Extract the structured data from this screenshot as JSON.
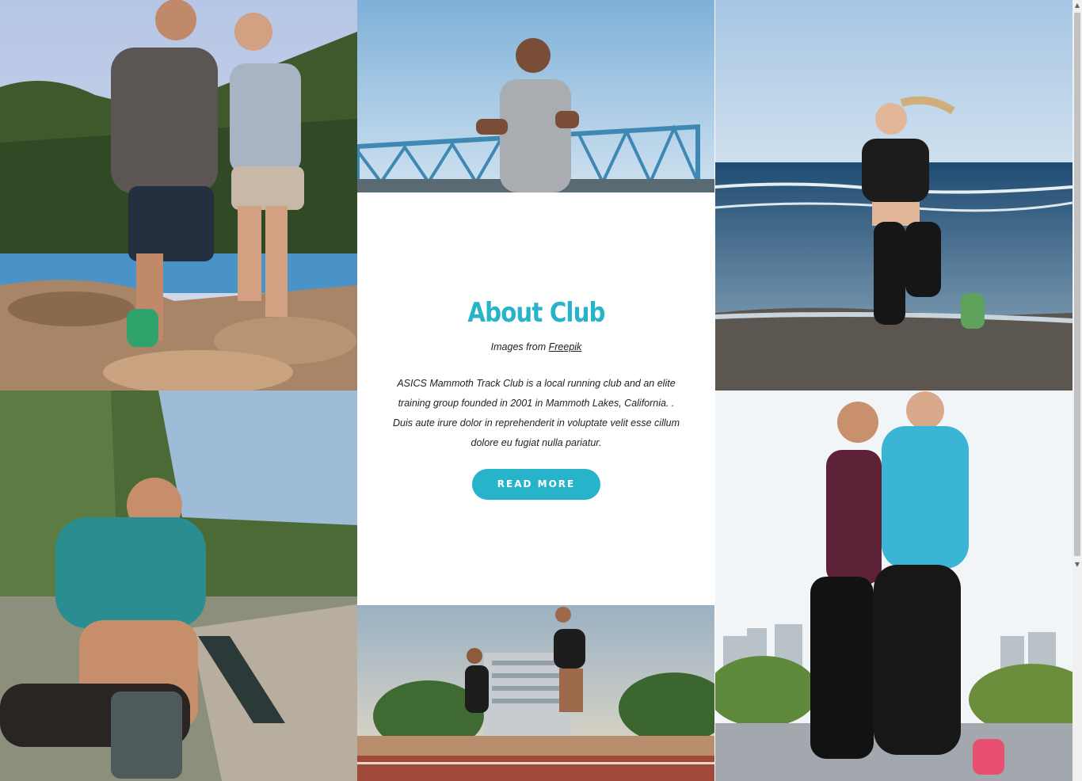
{
  "about": {
    "title": "About Club",
    "credit_prefix": "Images from",
    "credit_link": "Freepik",
    "body": "ASICS Mammoth Track Club is a local running club and an elite training group founded in 2001 in Mammoth Lakes, California. . Duis aute irure dolor in reprehenderit in voluptate velit esse cillum dolore eu fugiat nulla pariatur.",
    "button_label": "READ MORE"
  },
  "colors": {
    "accent": "#27b3c9",
    "text": "#222222",
    "background": "#ffffff"
  },
  "gallery": [
    {
      "id": "tile-1",
      "subject": "couple running on rocky lakeshore"
    },
    {
      "id": "tile-2",
      "subject": "man jogging on bridge with earphones"
    },
    {
      "id": "tile-3",
      "subject": "woman running on beach"
    },
    {
      "id": "tile-4",
      "subject": "man stretching leg in park"
    },
    {
      "id": "tile-5",
      "subject": "two athletes sprinting on track"
    },
    {
      "id": "tile-6",
      "subject": "couple jogging in city"
    }
  ]
}
